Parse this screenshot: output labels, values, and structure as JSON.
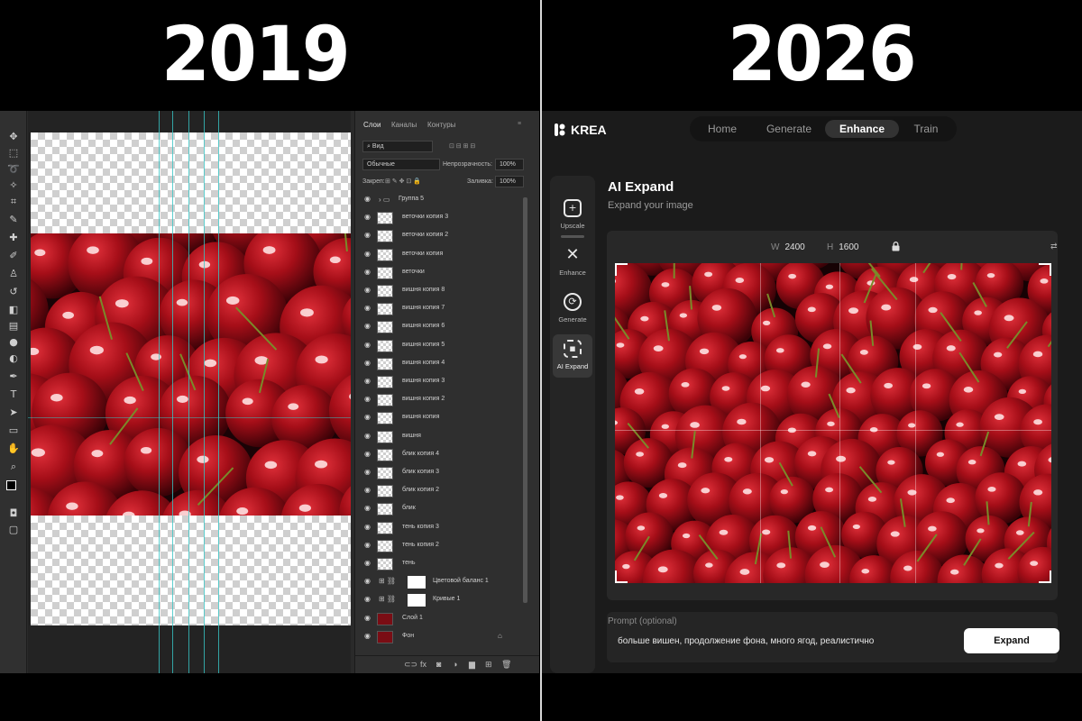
{
  "header": {
    "left_year": "2019",
    "right_year": "2026"
  },
  "photoshop": {
    "tabs": [
      "Слои",
      "Каналы",
      "Контуры"
    ],
    "filter_label": "Вид",
    "blend_mode": "Обычные",
    "opacity_label": "Непрозрачность:",
    "opacity_value": "100%",
    "lock_label": "Закреп:",
    "fill_label": "Заливка:",
    "fill_value": "100%",
    "layers": [
      {
        "name": "Группа 5",
        "kind": "group"
      },
      {
        "name": "веточки копия 3",
        "kind": "layer"
      },
      {
        "name": "веточки копия 2",
        "kind": "layer"
      },
      {
        "name": "веточки копия",
        "kind": "layer"
      },
      {
        "name": "веточки",
        "kind": "layer"
      },
      {
        "name": "вишня копия 8",
        "kind": "layer"
      },
      {
        "name": "вишня копия 7",
        "kind": "layer"
      },
      {
        "name": "вишня копия 6",
        "kind": "layer"
      },
      {
        "name": "вишня копия 5",
        "kind": "layer"
      },
      {
        "name": "вишня копия 4",
        "kind": "layer"
      },
      {
        "name": "вишня копия 3",
        "kind": "layer"
      },
      {
        "name": "вишня копия 2",
        "kind": "layer"
      },
      {
        "name": "вишня копия",
        "kind": "layer"
      },
      {
        "name": "вишня",
        "kind": "layer"
      },
      {
        "name": "блик копия 4",
        "kind": "layer"
      },
      {
        "name": "блик копия 3",
        "kind": "layer"
      },
      {
        "name": "блик копия 2",
        "kind": "layer"
      },
      {
        "name": "блик",
        "kind": "layer"
      },
      {
        "name": "тень копия 3",
        "kind": "layer"
      },
      {
        "name": "тень копия 2",
        "kind": "layer"
      },
      {
        "name": "тень",
        "kind": "layer"
      },
      {
        "name": "Цветовой баланс 1",
        "kind": "adjustment"
      },
      {
        "name": "Кривые 1",
        "kind": "adjustment"
      },
      {
        "name": "Слой 1",
        "kind": "image"
      },
      {
        "name": "Фон",
        "kind": "image"
      }
    ]
  },
  "krea": {
    "logo": "KREA",
    "nav": [
      "Home",
      "Generate",
      "Enhance",
      "Train"
    ],
    "nav_active": "Enhance",
    "sidebar": [
      "Upscale",
      "Enhance",
      "Generate",
      "AI Expand"
    ],
    "sidebar_active": "AI Expand",
    "title": "AI Expand",
    "subtitle": "Expand your image",
    "width_label": "W",
    "width_value": "2400",
    "height_label": "H",
    "height_value": "1600",
    "prompt_label": "Prompt (optional)",
    "prompt_text": "больше вишен, продолжение фона, много ягод, реалистично",
    "expand_button": "Expand"
  },
  "colors": {
    "cherry_red": "#b3121c",
    "guide_cyan": "#37c4c4",
    "krea_bg": "#1b1b1b"
  }
}
